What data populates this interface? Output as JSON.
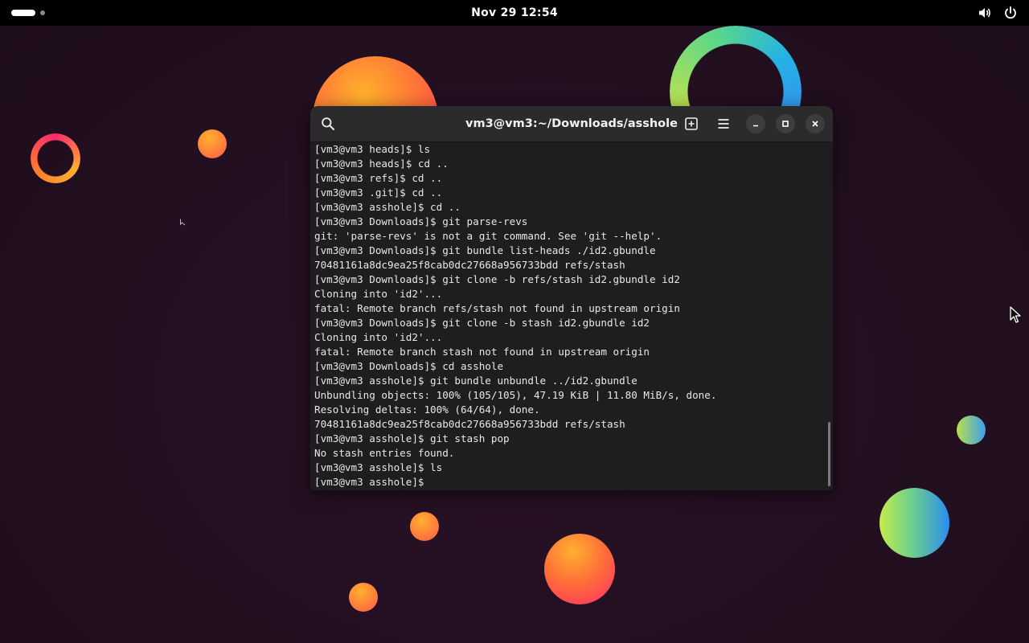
{
  "topbar": {
    "clock": "Nov 29  12:54",
    "icons": [
      "volume-icon",
      "power-icon"
    ]
  },
  "terminal_window": {
    "title": "vm3@vm3:~/Downloads/asshole",
    "header_icons": [
      "search-icon",
      "new-tab-icon",
      "menu-icon"
    ],
    "window_controls": [
      "minimize-icon",
      "maximize-icon",
      "close-icon"
    ],
    "lines": [
      "[vm3@vm3 heads]$ ls",
      "[vm3@vm3 heads]$ cd ..",
      "[vm3@vm3 refs]$ cd ..",
      "[vm3@vm3 .git]$ cd ..",
      "[vm3@vm3 asshole]$ cd ..",
      "[vm3@vm3 Downloads]$ git parse-revs",
      "git: 'parse-revs' is not a git command. See 'git --help'.",
      "[vm3@vm3 Downloads]$ git bundle list-heads ./id2.gbundle",
      "70481161a8dc9ea25f8cab0dc27668a956733bdd refs/stash",
      "[vm3@vm3 Downloads]$ git clone -b refs/stash id2.gbundle id2",
      "Cloning into 'id2'...",
      "fatal: Remote branch refs/stash not found in upstream origin",
      "[vm3@vm3 Downloads]$ git clone -b stash id2.gbundle id2",
      "Cloning into 'id2'...",
      "fatal: Remote branch stash not found in upstream origin",
      "[vm3@vm3 Downloads]$ cd asshole",
      "[vm3@vm3 asshole]$ git bundle unbundle ../id2.gbundle",
      "Unbundling objects: 100% (105/105), 47.19 KiB | 11.80 MiB/s, done.",
      "Resolving deltas: 100% (64/64), done.",
      "70481161a8dc9ea25f8cab0dc27668a956733bdd refs/stash",
      "[vm3@vm3 asshole]$ git stash pop",
      "No stash entries found.",
      "[vm3@vm3 asshole]$ ls",
      "[vm3@vm3 asshole]$ "
    ]
  },
  "colors": {
    "desktop_bg": "#241022",
    "topbar_bg": "#000000",
    "headerbar_bg": "#2b2b2b",
    "terminal_bg": "#1e1e1e",
    "terminal_fg": "#e8e8e8"
  }
}
